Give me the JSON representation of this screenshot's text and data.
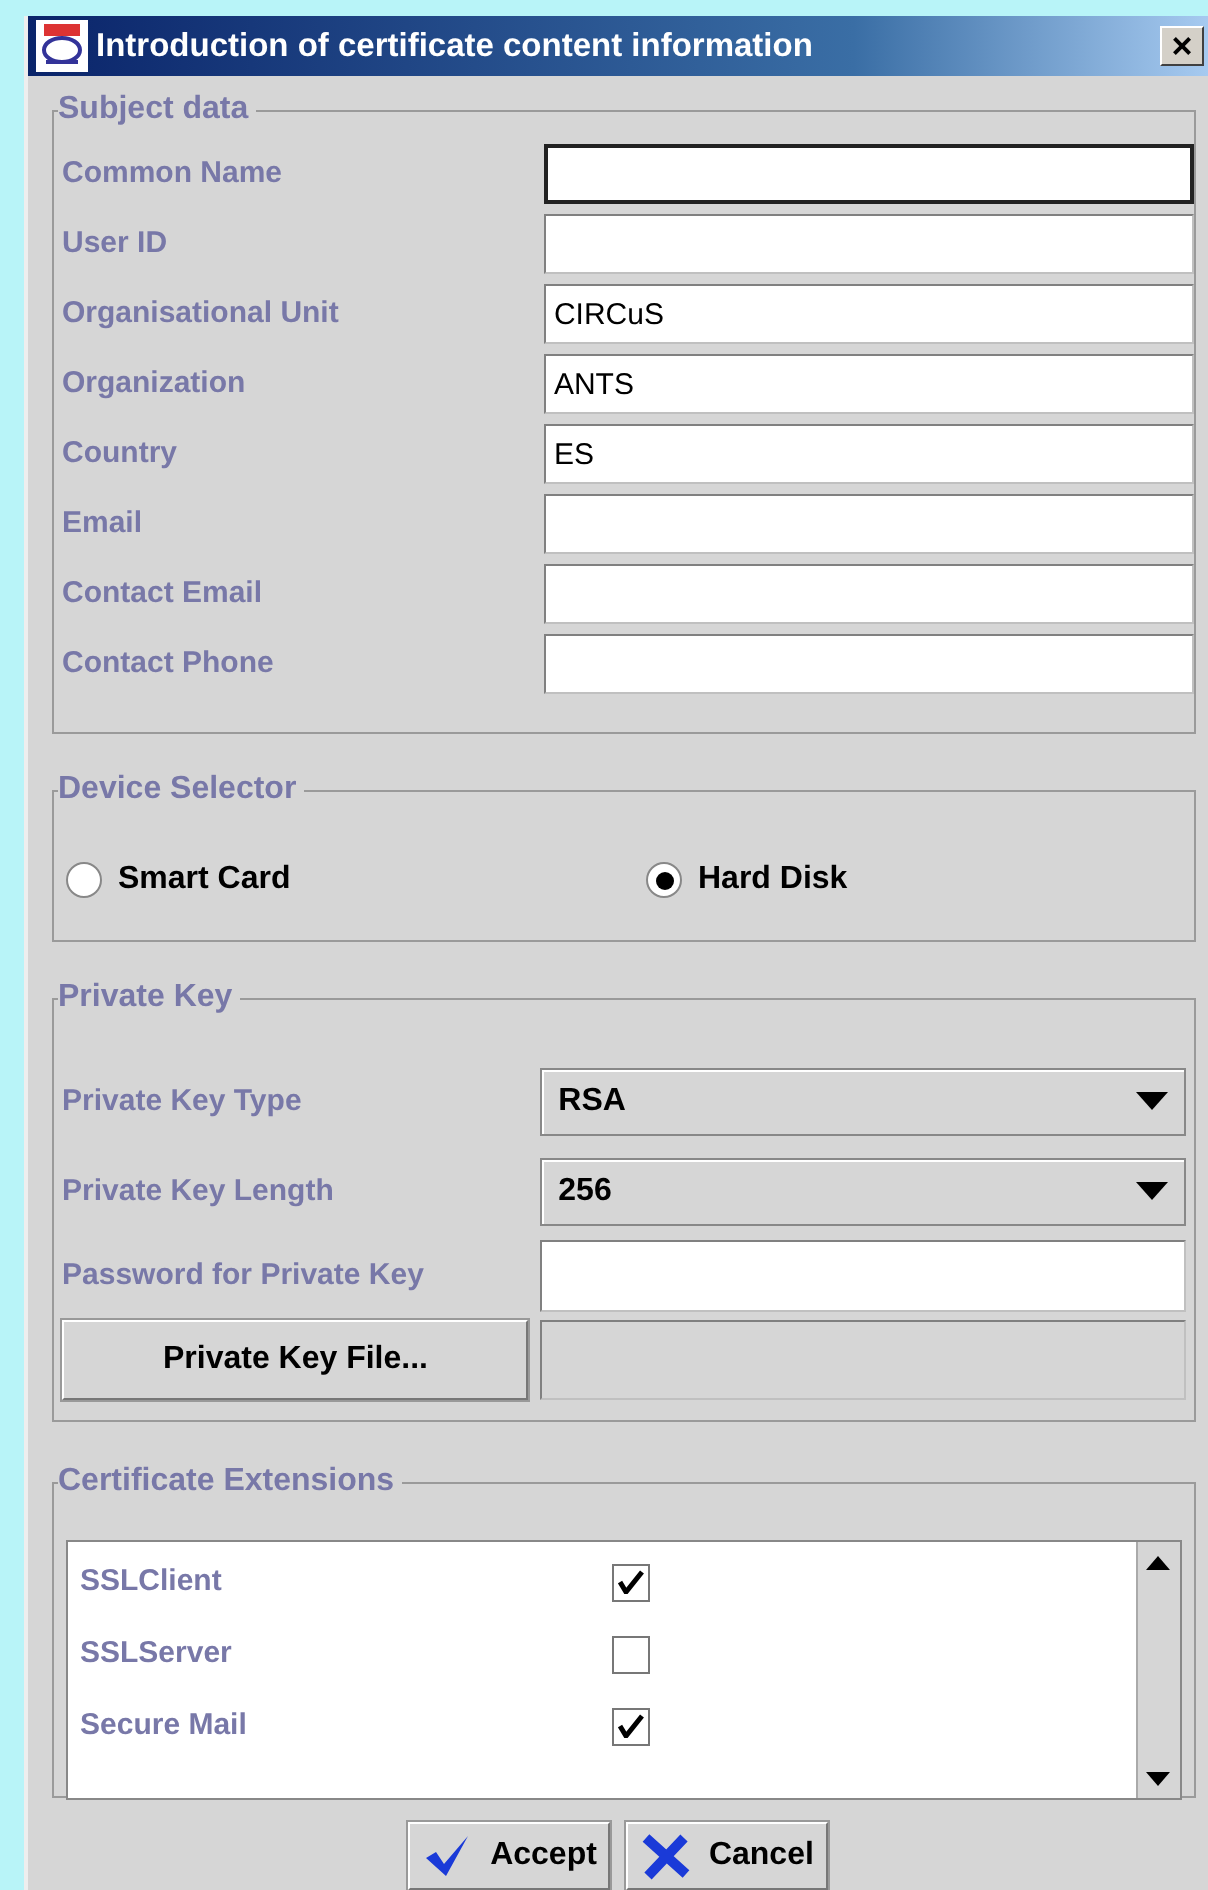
{
  "window": {
    "title": "Introduction of certificate content information",
    "close": "×"
  },
  "subject_data": {
    "title": "Subject data",
    "fields": [
      {
        "label": "Common Name",
        "focused": true
      },
      {
        "label": "User ID",
        "focused": false
      },
      {
        "label": "Organisational Unit",
        "value": "CIRCuS",
        "focused": false
      },
      {
        "label": "Organization",
        "value": "ANTS",
        "focused": false
      },
      {
        "label": "Country",
        "value": "ES",
        "focused": false
      },
      {
        "label": "Email",
        "focused": false
      },
      {
        "label": "Contact Email",
        "focused": false
      },
      {
        "label": "Contact Phone",
        "focused": false
      }
    ]
  },
  "device_selector": {
    "title": "Device Selector",
    "options": [
      {
        "label": "Smart Card",
        "selected": false
      },
      {
        "label": "Hard Disk",
        "selected": true
      }
    ]
  },
  "private_key": {
    "title": "Private Key",
    "rows": [
      {
        "kind": "select",
        "label": "Private Key Type",
        "value": "RSA"
      },
      {
        "kind": "select",
        "label": "Private Key Length",
        "value": "256"
      },
      {
        "kind": "password",
        "label": "Password for Private Key"
      },
      {
        "kind": "file",
        "button": "Private Key File..."
      }
    ]
  },
  "certificate_extensions": {
    "title": "Certificate Extensions",
    "items": [
      {
        "label": "SSLClient",
        "checked": true
      },
      {
        "label": "SSLServer",
        "checked": false
      },
      {
        "label": "Secure Mail",
        "checked": true
      }
    ]
  },
  "buttons": [
    {
      "kind": "accept",
      "label": "Accept"
    },
    {
      "kind": "cancel",
      "label": "Cancel"
    }
  ]
}
